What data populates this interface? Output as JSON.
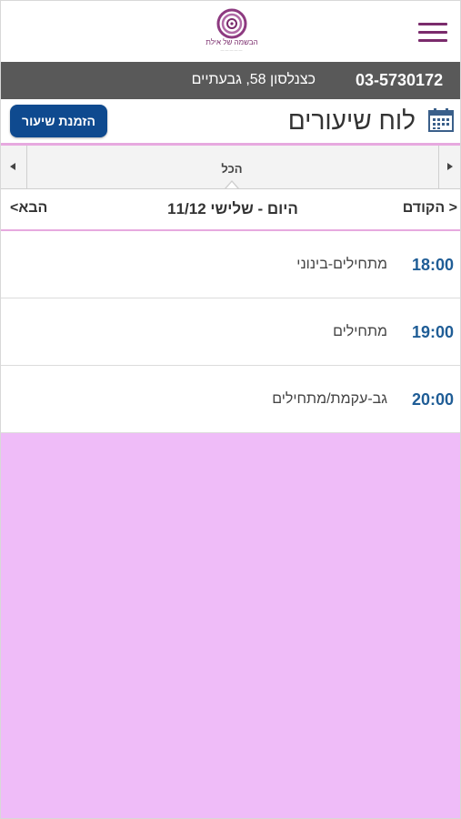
{
  "header": {
    "logo_text": "הבשמה של אילת",
    "phone": "03-5730172",
    "address": "כצנלסון 58, גבעתיים",
    "page_title": "לוח שיעורים",
    "book_button_label": "הזמנת שיעור"
  },
  "filter": {
    "selected": "הכל"
  },
  "day_nav": {
    "prev_label": "הקודם",
    "next_label": "הבא",
    "day_title": "היום - שלישי 11/12"
  },
  "lessons": [
    {
      "time": "18:00",
      "name": "מתחילים-בינוני"
    },
    {
      "time": "19:00",
      "name": "מתחילים"
    },
    {
      "time": "20:00",
      "name": "גב-עקמת/מתחילים"
    }
  ],
  "colors": {
    "brand_purple": "#7a2b6c",
    "accent_pink": "#e7a9df",
    "background_pink": "#efbcf8",
    "button_blue": "#0f4a8f",
    "time_blue": "#1f5d96",
    "contact_bar": "#595959"
  },
  "icons": [
    "menu-icon",
    "calendar-icon",
    "chevron-left-icon",
    "chevron-right-icon"
  ]
}
